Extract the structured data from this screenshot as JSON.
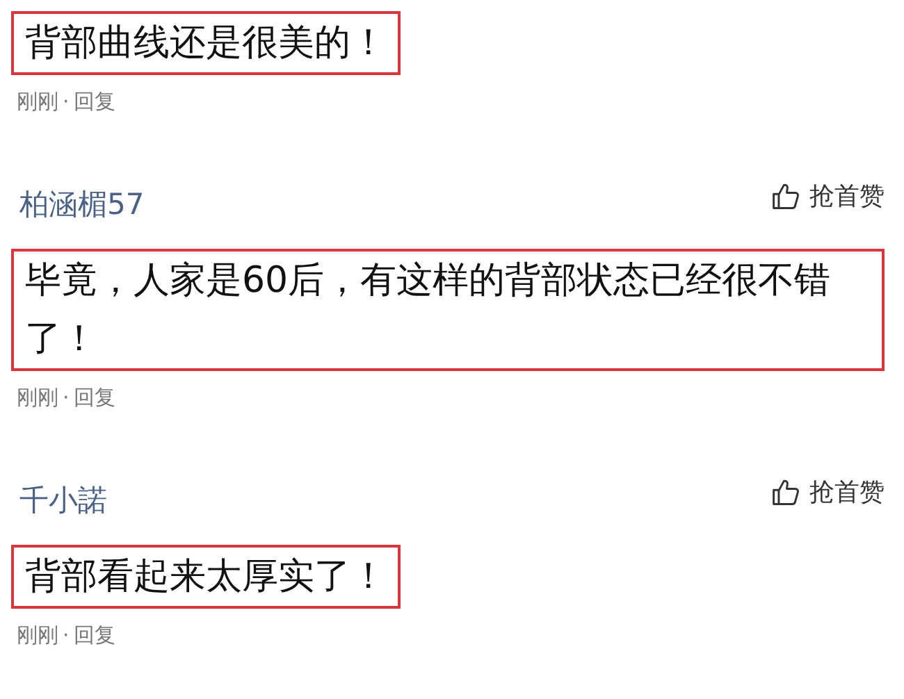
{
  "comments": [
    {
      "text": "背部曲线还是很美的！",
      "highlighted": true,
      "time": "刚刚",
      "separator": "·",
      "reply": "回复"
    },
    {
      "username": "柏涵楣57",
      "like_label": "抢首赞",
      "text": "毕竟，人家是60后，有这样的背部状态已经很不错了！",
      "highlighted": true,
      "time": "刚刚",
      "separator": "·",
      "reply": "回复"
    },
    {
      "username": "千小諾",
      "like_label": "抢首赞",
      "text": "背部看起来太厚实了！",
      "highlighted": true,
      "time": "刚刚",
      "separator": "·",
      "reply": "回复"
    }
  ]
}
